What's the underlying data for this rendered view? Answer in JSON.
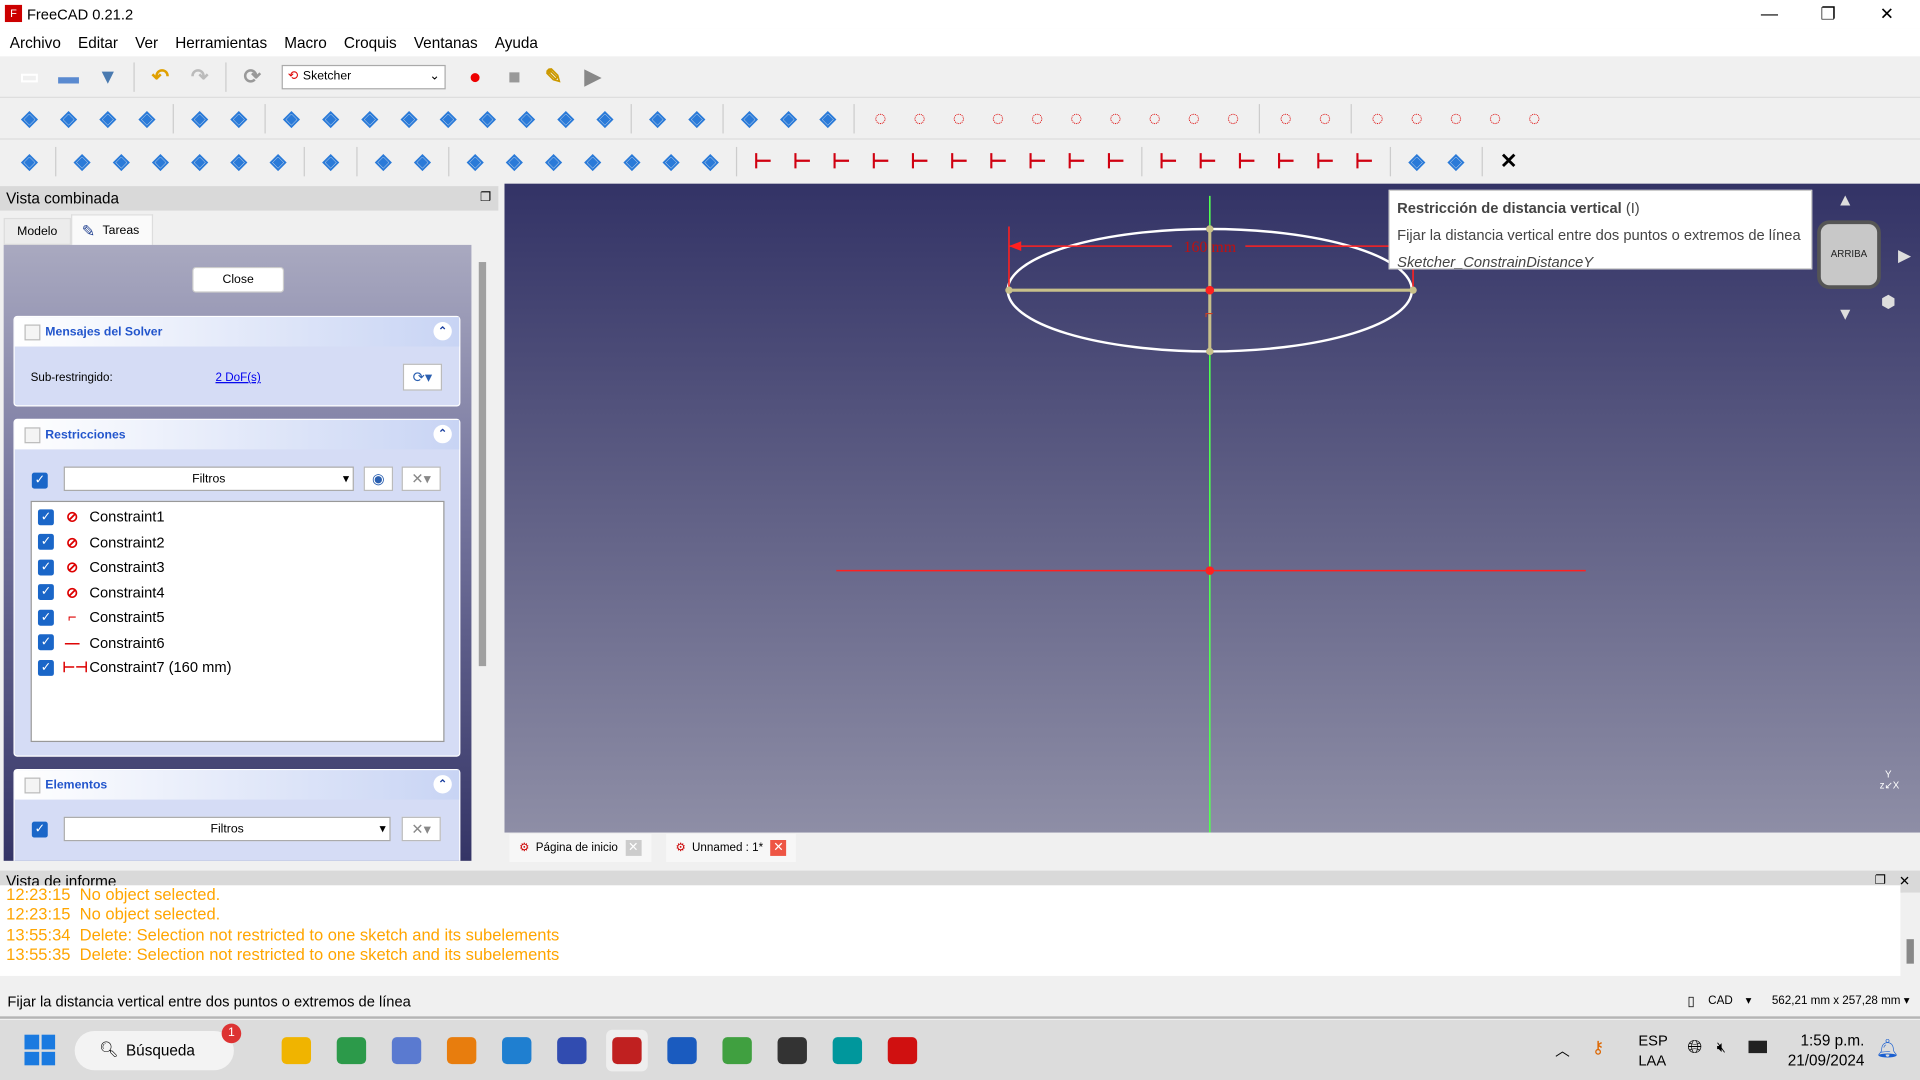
{
  "app": {
    "title": "FreeCAD 0.21.2",
    "window_buttons": [
      "—",
      "❐",
      "✕"
    ]
  },
  "menu": [
    "Archivo",
    "Editar",
    "Ver",
    "Herramientas",
    "Macro",
    "Croquis",
    "Ventanas",
    "Ayuda"
  ],
  "toolbar1": {
    "workbench": "Sketcher",
    "icons": [
      "new-file",
      "open-file",
      "save-file",
      "undo",
      "redo",
      "refresh",
      "macro-record",
      "macro-stop",
      "macro-edit",
      "macro-run"
    ]
  },
  "toolbar2": {
    "icons": [
      "fit-all",
      "fit-selection",
      "draw-style",
      "bounding-box",
      "nav-back",
      "nav-forward",
      "std-views",
      "zoom",
      "isometric",
      "front",
      "top",
      "right",
      "rear",
      "bottom",
      "left",
      "measure",
      "whats-this",
      "sketch-leave",
      "view-sketch",
      "view-section",
      "point",
      "line",
      "arc",
      "circle",
      "conic",
      "bspline",
      "polyline",
      "rectangle",
      "polygon",
      "slot",
      "fillet",
      "trim",
      "extend",
      "split",
      "external",
      "carbon-copy",
      "construction"
    ]
  },
  "toolbar3": {
    "icons": [
      "validate",
      "close-shape",
      "connect",
      "select-constraints",
      "select-origin",
      "select-elements",
      "mirror",
      "grid",
      "snap",
      "render-order",
      "symmetry",
      "clone",
      "copy",
      "move",
      "array",
      "scale",
      "remove-axes",
      "constrain-coincident",
      "constrain-point-on-object",
      "constrain-vertical",
      "constrain-horizontal",
      "constrain-parallel",
      "constrain-perpendicular",
      "constrain-tangent",
      "constrain-equal",
      "constrain-symmetric",
      "constrain-block",
      "constrain-lock",
      "constrain-distance-x",
      "constrain-distance-y",
      "constrain-distance",
      "constrain-radius",
      "constrain-angle",
      "toggle-driving",
      "toggle-active",
      "close-x"
    ]
  },
  "combined_view": {
    "title": "Vista combinada",
    "tabs": [
      "Modelo",
      "Tareas"
    ],
    "active_tab": "Tareas",
    "close_button": "Close",
    "solver": {
      "title": "Mensajes del Solver",
      "label": "Sub-restringido:",
      "link": "2 DoF(s)"
    },
    "constraints": {
      "title": "Restricciones",
      "filter": "Filtros",
      "items": [
        {
          "name": "Constraint1",
          "icon": "tangent-icon"
        },
        {
          "name": "Constraint2",
          "icon": "point-on-object-icon"
        },
        {
          "name": "Constraint3",
          "icon": "point-on-object-icon"
        },
        {
          "name": "Constraint4",
          "icon": "tangent-icon"
        },
        {
          "name": "Constraint5",
          "icon": "angle-icon"
        },
        {
          "name": "Constraint6",
          "icon": "horizontal-icon"
        },
        {
          "name": "Constraint7 (160 mm)",
          "icon": "horizontal-distance-icon"
        }
      ]
    },
    "elements": {
      "title": "Elementos",
      "filter": "Filtros"
    }
  },
  "viewport": {
    "dimension_label": "160 mm",
    "navcube_face": "ARRIBA",
    "colors": {
      "x_axis": "#ff2020",
      "y_axis": "#50ff50",
      "geometry": "#ffffff",
      "construction": "#c8c08a"
    }
  },
  "tooltip": {
    "title": "Restricción de distancia vertical",
    "shortcut": "(I)",
    "description": "Fijar la distancia vertical entre dos puntos o extremos de línea",
    "command": "Sketcher_ConstrainDistanceY"
  },
  "doc_tabs": [
    {
      "label": "Página de inicio"
    },
    {
      "label": "Unnamed : 1*"
    }
  ],
  "report": {
    "title": "Vista de informe",
    "lines": [
      "12:23:15  No object selected.",
      "12:23:15  No object selected.",
      "13:55:34  Delete: Selection not restricted to one sketch and its subelements",
      "13:55:35  Delete: Selection not restricted to one sketch and its subelements"
    ]
  },
  "status": {
    "message": "Fijar la distancia vertical entre dos puntos o extremos de línea",
    "nav_style": "CAD",
    "dimensions": "562,21 mm x 257,28 mm"
  },
  "taskbar": {
    "search": "Búsqueda",
    "search_badge": "1",
    "apps": [
      "file-explorer",
      "chrome",
      "snipping-tool",
      "blender",
      "vscode",
      "kicad",
      "freecad",
      "word",
      "app-green",
      "inkscape",
      "arduino",
      "acrobat"
    ],
    "lang": "ESP",
    "lang2": "LAA",
    "time": "1:59 p.m.",
    "date": "21/09/2024"
  }
}
